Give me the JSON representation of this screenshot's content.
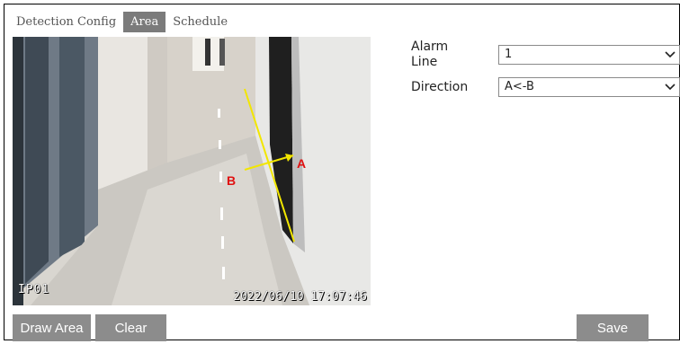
{
  "tabs": [
    {
      "label": "Detection Config",
      "active": false
    },
    {
      "label": "Area",
      "active": true
    },
    {
      "label": "Schedule",
      "active": false
    }
  ],
  "camera": {
    "channel": "IP01",
    "timestamp": "2022/06/10 17:07:46",
    "line_labels": {
      "a": "A",
      "b": "B"
    }
  },
  "form": {
    "alarm_line": {
      "label_line1": "Alarm",
      "label_line2": "Line",
      "value": "1"
    },
    "direction": {
      "label": "Direction",
      "value": "A<-B"
    }
  },
  "buttons": {
    "draw_area": "Draw Area",
    "clear": "Clear",
    "save": "Save"
  },
  "colors": {
    "active_tab": "#7b7b7b",
    "button": "#8c8c8c",
    "alarm_line": "#f2e600",
    "label_red": "#e01010"
  }
}
